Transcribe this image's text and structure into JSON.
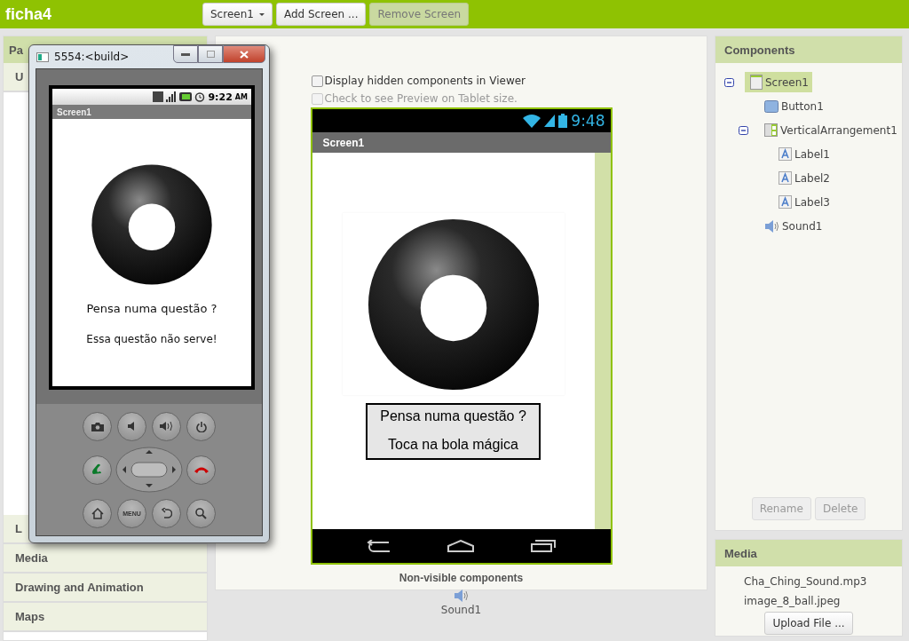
{
  "app": {
    "title": "ficha4"
  },
  "toolbar": {
    "buttons": [
      {
        "label": "Screen1",
        "kind": "dropdown",
        "disabled": false
      },
      {
        "label": "Add Screen ...",
        "kind": "button",
        "disabled": false
      },
      {
        "label": "Remove Screen",
        "kind": "button",
        "disabled": true
      }
    ]
  },
  "palette": {
    "title": "Pa",
    "sections": [
      {
        "label": "U"
      },
      {
        "label": "L"
      },
      {
        "label": "Media"
      },
      {
        "label": "Drawing and Animation"
      },
      {
        "label": "Maps"
      }
    ]
  },
  "emulator": {
    "title": "5554:<build>",
    "status_time": "9:22",
    "status_ampm": "AM",
    "screen_title": "Screen1",
    "labels": [
      "Pensa numa questão ?",
      "Essa questão não serve!"
    ],
    "menu_key": "MENU"
  },
  "viewer": {
    "options": [
      {
        "label": "Display hidden components in Viewer",
        "checked": false,
        "disabled": false
      },
      {
        "label": "Check to see Preview on Tablet size.",
        "checked": false,
        "disabled": true
      }
    ],
    "phone": {
      "time": "9:48",
      "screen_title": "Screen1",
      "labels": [
        "Pensa numa questão ?",
        "Toca na bola mágica"
      ]
    },
    "nonvisible": {
      "title": "Non-visible components",
      "items": [
        "Sound1"
      ]
    }
  },
  "components": {
    "title": "Components",
    "tree": [
      {
        "label": "Screen1",
        "kind": "screen",
        "selected": true,
        "expanded": true,
        "children": [
          {
            "label": "Button1",
            "kind": "button",
            "selected": false
          },
          {
            "label": "VerticalArrangement1",
            "kind": "arrangement",
            "selected": false,
            "expanded": true,
            "children": [
              {
                "label": "Label1",
                "kind": "label",
                "selected": false
              },
              {
                "label": "Label2",
                "kind": "label",
                "selected": false
              },
              {
                "label": "Label3",
                "kind": "label",
                "selected": false
              }
            ]
          },
          {
            "label": "Sound1",
            "kind": "sound",
            "selected": false
          }
        ]
      }
    ],
    "buttons": [
      {
        "label": "Rename",
        "disabled": true
      },
      {
        "label": "Delete",
        "disabled": true
      }
    ]
  },
  "media": {
    "title": "Media",
    "files": [
      "Cha_Ching_Sound.mp3",
      "image_8_ball.jpeg"
    ],
    "button": "Upload File ..."
  }
}
